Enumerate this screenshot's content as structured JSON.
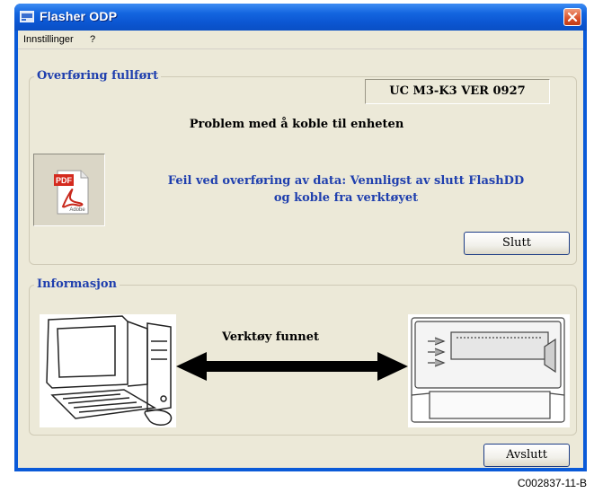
{
  "window": {
    "title": "Flasher ODP"
  },
  "menu": {
    "items": [
      "Innstillinger",
      "?"
    ]
  },
  "transfer_group": {
    "title": "Overføring fullført",
    "version": "UC M3-K3 VER 0927",
    "problem_text": "Problem med å koble til enheten",
    "error_line1": "Feil ved overføring av data: Vennligst av slutt FlashDD",
    "error_line2": "og koble fra verktøyet",
    "pdf_label": "PDF",
    "adobe_label": "Adobe",
    "close_button": "Slutt"
  },
  "info_group": {
    "title": "Informasjon",
    "tool_status": "Verktøy funnet"
  },
  "exit_button": "Avslutt",
  "figure_code": "C002837-11-B",
  "colors": {
    "titlebar": "#0b56d2",
    "group_title": "#1f3fae",
    "error_text": "#1f3fae",
    "client_bg": "#ece9d8"
  }
}
